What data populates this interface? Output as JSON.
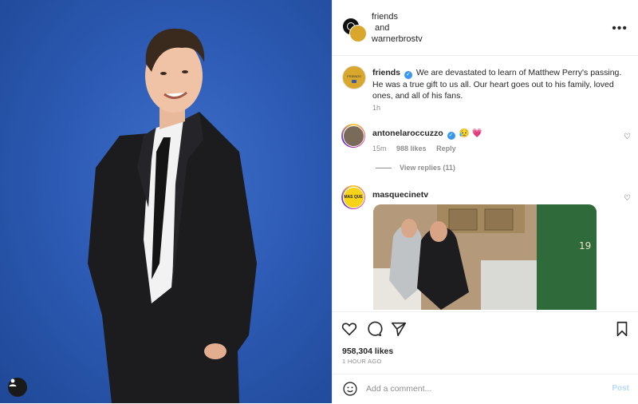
{
  "header": {
    "account1": "friends",
    "joiner": "and",
    "account2": "warnerbrostv",
    "more_icon": "more-horizontal-icon"
  },
  "caption": {
    "username": "friends",
    "text": "We are devastated to learn of Matthew Perry's passing. He was a true gift to us all. Our heart goes out to his family, loved ones, and all of his fans.",
    "time": "1h"
  },
  "comments": [
    {
      "username": "antonelaroccuzzo",
      "verified": true,
      "emojis": "😥 💗",
      "time": "15m",
      "likes": "988 likes",
      "reply": "Reply",
      "view_replies": "View replies (11)"
    },
    {
      "username": "masquecinetv",
      "avatar_text": "MAS QUE CINE"
    }
  ],
  "actions": {
    "like_icon": "heart-icon",
    "comment_icon": "comment-icon",
    "share_icon": "send-icon",
    "save_icon": "bookmark-icon"
  },
  "likes": "958,304 likes",
  "posted_ago": "1 HOUR AGO",
  "comment_box": {
    "placeholder": "Add a comment...",
    "post_label": "Post"
  },
  "colors": {
    "photo_background": "#2d5bb5",
    "verified_badge": "#3897f0",
    "post_button_disabled": "#b8d9f9"
  }
}
